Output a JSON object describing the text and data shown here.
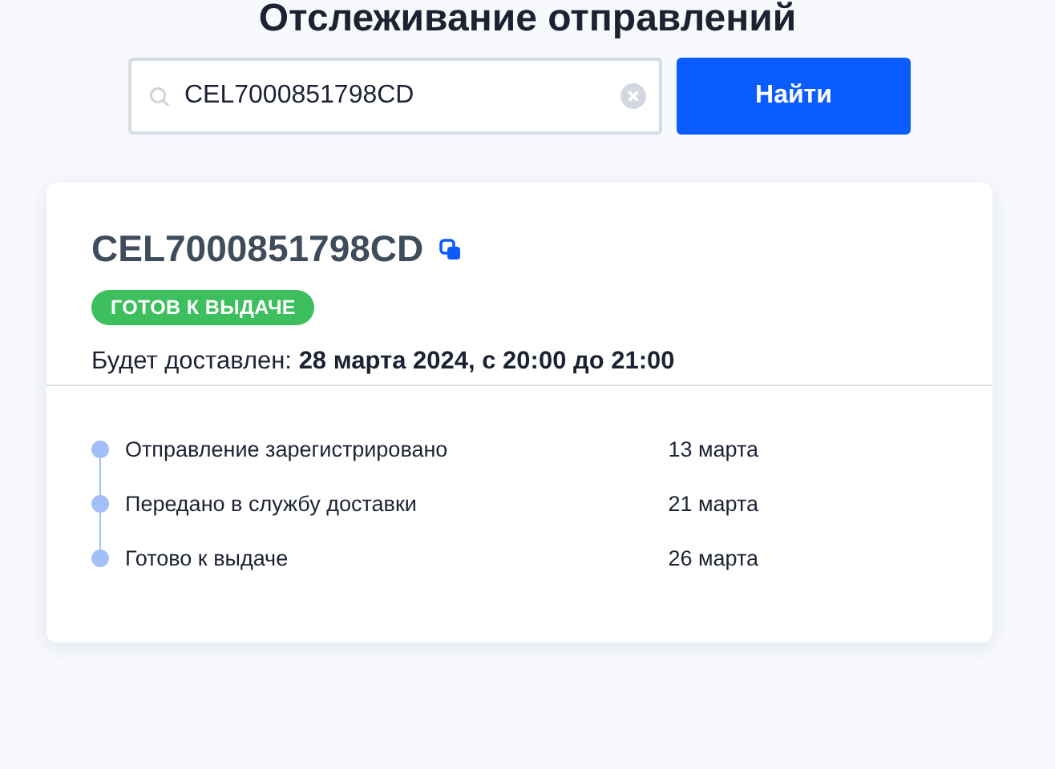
{
  "page_title": "Отслеживание отправлений",
  "search": {
    "value": "CEL7000851798CD",
    "button": "Найти"
  },
  "shipment": {
    "tracking_number": "CEL7000851798CD",
    "status": {
      "label": "ГОТОВ К ВЫДАЧЕ",
      "color": "#3dbf5e"
    },
    "delivery_label": "Будет доставлен:",
    "delivery_value": "28 марта 2024, с 20:00 до 21:00",
    "events": [
      {
        "title": "Отправление зарегистрировано",
        "date": "13 марта"
      },
      {
        "title": "Передано в службу доставки",
        "date": "21 марта"
      },
      {
        "title": "Готово к выдаче",
        "date": "26 марта"
      }
    ]
  }
}
